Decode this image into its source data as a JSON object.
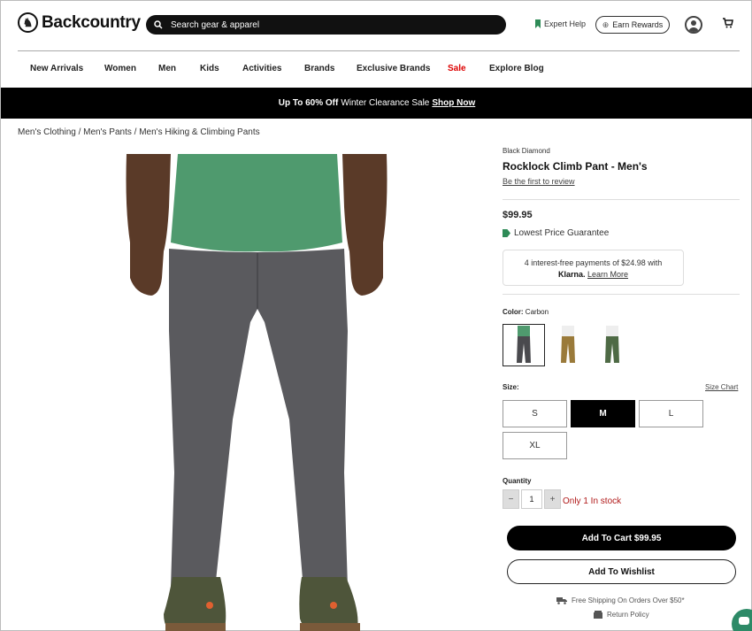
{
  "header": {
    "logo_text": "Backcountry",
    "search_placeholder": "Search gear & apparel",
    "expert_help": "Expert Help",
    "earn_rewards": "Earn Rewards"
  },
  "nav": {
    "items": [
      "New Arrivals",
      "Women",
      "Men",
      "Kids",
      "Activities",
      "Brands",
      "Exclusive Brands",
      "Sale",
      "Explore Blog"
    ]
  },
  "promo": {
    "bold": "Up To 60% Off",
    "text": "Winter Clearance Sale",
    "link": "Shop Now"
  },
  "breadcrumb": "Men's Clothing / Men's Pants / Men's Hiking & Climbing Pants",
  "product": {
    "brand": "Black Diamond",
    "title": "Rocklock Climb Pant - Men's",
    "review_link": "Be the first to review",
    "price": "$99.95",
    "guarantee": "Lowest Price Guarantee",
    "klarna_text": "4 interest-free payments of $24.98 with",
    "klarna_brand": "Klarna.",
    "klarna_link": "Learn More",
    "color_label": "Color:",
    "color_value": "Carbon",
    "swatch_colors": [
      "#4a4a4e",
      "#9a7a3a",
      "#4e6a45"
    ],
    "size_label": "Size:",
    "size_chart": "Size Chart",
    "sizes": [
      "S",
      "M",
      "L",
      "XL"
    ],
    "selected_size": "M",
    "quantity_label": "Quantity",
    "quantity_minus": "−",
    "quantity_value": "1",
    "quantity_plus": "+",
    "stock_text": "Only 1 In stock",
    "add_to_cart": "Add To Cart $99.95",
    "add_to_wishlist": "Add To Wishlist",
    "shipping": "Free Shipping On Orders Over $50*",
    "returns": "Return Policy"
  },
  "colors": {
    "sale": "#dd0000",
    "shirt": "#4f9a6e",
    "pants": "#5a5a5e",
    "chat": "#2d8a67"
  }
}
